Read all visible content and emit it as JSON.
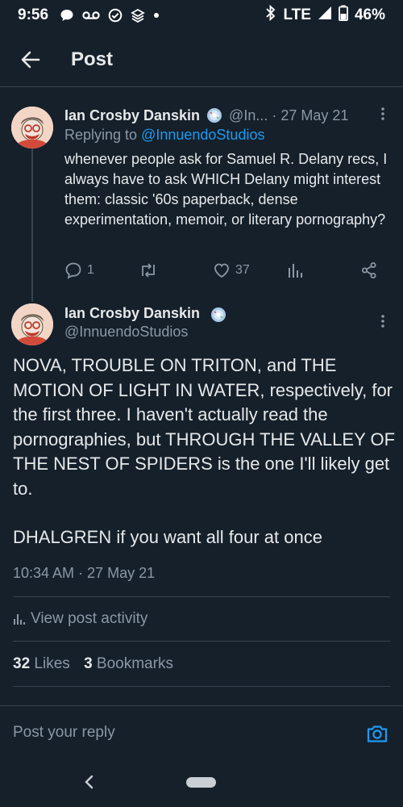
{
  "status_bar": {
    "time": "9:56",
    "network": "LTE",
    "battery": "46%",
    "icons": [
      "message-icon",
      "voicemail-icon",
      "check-circle-icon",
      "layers-icon",
      "dot-icon",
      "bluetooth-icon",
      "signal-icon",
      "battery-icon"
    ]
  },
  "header": {
    "title": "Post",
    "back_icon": "arrow-left-icon"
  },
  "parent_post": {
    "author_name": "Ian Crosby Danskin",
    "handle_truncated": "@In...",
    "separator": "·",
    "date": "27 May 21",
    "replying_prefix": "Replying to",
    "replying_to": "@InnuendoStudios",
    "text": "whenever people ask for Samuel R. Delany recs, I always have to ask WHICH Delany might interest them: classic '60s paperback, dense experimentation, memoir, or literary pornography?",
    "actions": {
      "replies": "1",
      "reposts": "",
      "likes": "37"
    }
  },
  "main_post": {
    "author_name": "Ian Crosby Danskin",
    "handle": "@InnuendoStudios",
    "paragraph_1": "NOVA, TROUBLE ON TRITON, and THE MOTION OF LIGHT IN WATER, respectively, for the first three. I haven't actually read the pornographies, but THROUGH THE VALLEY OF THE NEST OF SPIDERS is the one I'll likely get to.",
    "paragraph_2": "DHALGREN if you want all four at once",
    "timestamp": "10:34 AM · 27 May 21",
    "view_activity": "View post activity",
    "likes_count": "32",
    "likes_label": "Likes",
    "bookmarks_count": "3",
    "bookmarks_label": "Bookmarks"
  },
  "reply_bar": {
    "placeholder": "Post your reply"
  },
  "colors": {
    "background": "#15202b",
    "accent": "#1d9bf0",
    "muted": "#8b98a5",
    "text": "#e7e9ea",
    "divider": "#38444d"
  }
}
